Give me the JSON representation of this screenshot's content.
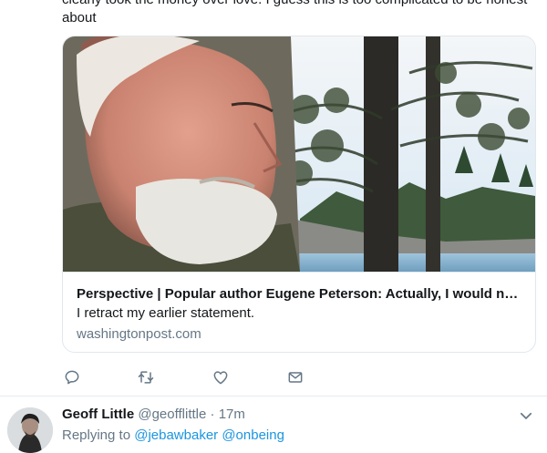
{
  "tweet": {
    "text": "clearly took the money over love. I guess this is too complicated to be honest about"
  },
  "card": {
    "title": "Perspective | Popular author Eugene Peterson: Actually, I would not p...",
    "description": "I retract my earlier statement.",
    "domain": "washingtonpost.com"
  },
  "actions": [
    {
      "icon": "reply-icon"
    },
    {
      "icon": "retweet-icon"
    },
    {
      "icon": "like-icon"
    },
    {
      "icon": "message-icon"
    }
  ],
  "next_tweet": {
    "name": "Geoff Little",
    "handle": "@geofflittle",
    "separator": "·",
    "time": "17m",
    "replying_prefix": "Replying to",
    "replying_to": "@jebawbaker @onbeing"
  },
  "colors": {
    "text": "#14171a",
    "secondary": "#657786",
    "link": "#1b95e0",
    "border": "#e1e8ed"
  }
}
